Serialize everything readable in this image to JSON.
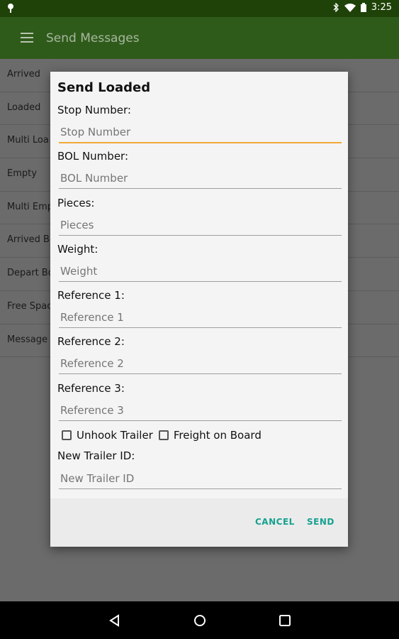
{
  "status_bar": {
    "time": "3:25",
    "icons": [
      "location-icon",
      "bluetooth-icon",
      "wifi-icon",
      "battery-icon"
    ]
  },
  "toolbar": {
    "title": "Send Messages",
    "menu_icon": "hamburger-menu-icon"
  },
  "list": {
    "items": [
      "Arrived",
      "Loaded",
      "Multi Loa",
      "Empty",
      "Multi Emp",
      "Arrived Bo",
      "Depart Bo",
      "Free Spac",
      "Message"
    ]
  },
  "dialog": {
    "title": "Send Loaded",
    "fields": [
      {
        "label": "Stop Number:",
        "placeholder": "Stop Number",
        "value": ""
      },
      {
        "label": "BOL Number:",
        "placeholder": "BOL Number",
        "value": ""
      },
      {
        "label": "Pieces:",
        "placeholder": "Pieces",
        "value": ""
      },
      {
        "label": "Weight:",
        "placeholder": "Weight",
        "value": ""
      },
      {
        "label": "Reference 1:",
        "placeholder": "Reference 1",
        "value": ""
      },
      {
        "label": "Reference 2:",
        "placeholder": "Reference 2",
        "value": ""
      },
      {
        "label": "Reference 3:",
        "placeholder": "Reference 3",
        "value": ""
      }
    ],
    "checkboxes": [
      {
        "label": "Unhook Trailer",
        "checked": false
      },
      {
        "label": "Freight on Board",
        "checked": false
      }
    ],
    "new_trailer": {
      "label": "New Trailer ID:",
      "placeholder": "New Trailer ID",
      "value": ""
    },
    "actions": {
      "cancel": "CANCEL",
      "send": "SEND"
    }
  },
  "colors": {
    "toolbar": "#2f5b1a",
    "status_bar": "#1e4208",
    "accent_input": "#f2a83b",
    "action_text": "#16a190"
  }
}
